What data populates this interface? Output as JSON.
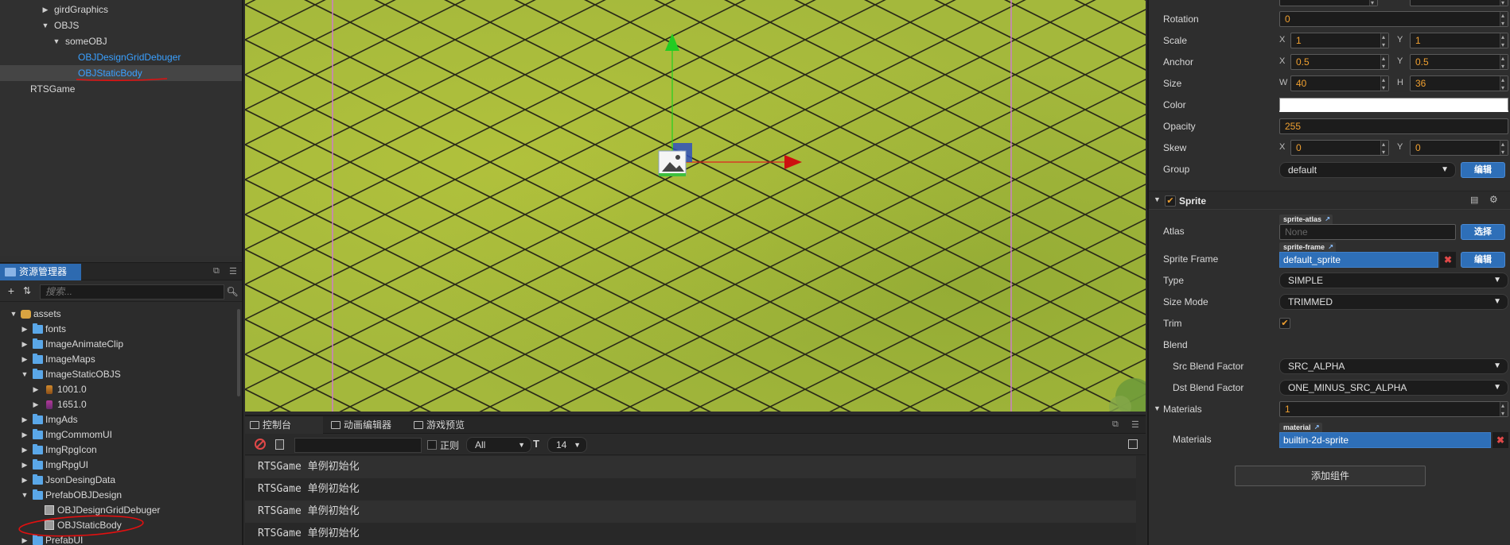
{
  "hierarchy": {
    "items": [
      {
        "label": "girdGraphics",
        "expanded": false
      },
      {
        "label": "OBJS",
        "expanded": true
      },
      {
        "label": "someOBJ",
        "expanded": true
      },
      {
        "label": "OBJDesignGridDebuger"
      },
      {
        "label": "OBJStaticBody",
        "selected": true
      },
      {
        "label": "RTSGame"
      }
    ]
  },
  "assets": {
    "tab_label": "资源管理器",
    "search_placeholder": "搜索...",
    "items": [
      {
        "label": "assets",
        "type": "db",
        "expanded": true
      },
      {
        "label": "fonts",
        "type": "folder"
      },
      {
        "label": "ImageAnimateClip",
        "type": "folder"
      },
      {
        "label": "ImageMaps",
        "type": "folder"
      },
      {
        "label": "ImageStaticOBJS",
        "type": "folder",
        "expanded": true
      },
      {
        "label": "1001.0",
        "type": "image"
      },
      {
        "label": "1651.0",
        "type": "image"
      },
      {
        "label": "ImgAds",
        "type": "folder"
      },
      {
        "label": "ImgCommomUI",
        "type": "folder"
      },
      {
        "label": "ImgRpgIcon",
        "type": "folder"
      },
      {
        "label": "ImgRpgUI",
        "type": "folder"
      },
      {
        "label": "JsonDesingData",
        "type": "folder"
      },
      {
        "label": "PrefabOBJDesign",
        "type": "folder",
        "expanded": true
      },
      {
        "label": "OBJDesignGridDebuger",
        "type": "prefab"
      },
      {
        "label": "OBJStaticBody",
        "type": "prefab",
        "circled": true
      },
      {
        "label": "PrefabUI",
        "type": "folder"
      }
    ]
  },
  "console": {
    "tabs": [
      "控制台",
      "动画编辑器",
      "游戏预览"
    ],
    "regex_label": "正则",
    "level_value": "All",
    "font_size_value": "14",
    "logs": [
      "RTSGame 单例初始化",
      "RTSGame 单例初始化",
      "RTSGame 单例初始化",
      "RTSGame 单例初始化"
    ]
  },
  "inspector": {
    "rotation": {
      "label": "Rotation",
      "value": "0"
    },
    "scale": {
      "label": "Scale",
      "x": "1",
      "y": "1"
    },
    "anchor": {
      "label": "Anchor",
      "x": "0.5",
      "y": "0.5"
    },
    "size": {
      "label": "Size",
      "w": "40",
      "h": "36"
    },
    "color": {
      "label": "Color",
      "value": "#ffffff"
    },
    "opacity": {
      "label": "Opacity",
      "value": "255"
    },
    "skew": {
      "label": "Skew",
      "x": "0",
      "y": "0"
    },
    "group": {
      "label": "Group",
      "value": "default",
      "edit": "编辑"
    },
    "axis": {
      "x": "X",
      "y": "Y",
      "w": "W",
      "h": "H"
    },
    "sprite": {
      "title": "Sprite",
      "atlas": {
        "label": "Atlas",
        "tag": "sprite-atlas",
        "value": "None",
        "button": "选择"
      },
      "sprite_frame": {
        "label": "Sprite Frame",
        "tag": "sprite-frame",
        "value": "default_sprite",
        "button": "编辑"
      },
      "type": {
        "label": "Type",
        "value": "SIMPLE"
      },
      "size_mode": {
        "label": "Size Mode",
        "value": "TRIMMED"
      },
      "trim": {
        "label": "Trim",
        "checked": true
      },
      "blend": {
        "label": "Blend"
      },
      "src_blend": {
        "label": "Src Blend Factor",
        "value": "SRC_ALPHA"
      },
      "dst_blend": {
        "label": "Dst Blend Factor",
        "value": "ONE_MINUS_SRC_ALPHA"
      }
    },
    "materials": {
      "label": "Materials",
      "count": "1",
      "item_label": "Materials",
      "tag": "material",
      "value": "builtin-2d-sprite"
    },
    "add_component": "添加组件"
  },
  "colors": {
    "accent": "#2e6fb8",
    "number": "#f0a030",
    "link": "#3aa0ff",
    "annotation": "#e01010"
  }
}
